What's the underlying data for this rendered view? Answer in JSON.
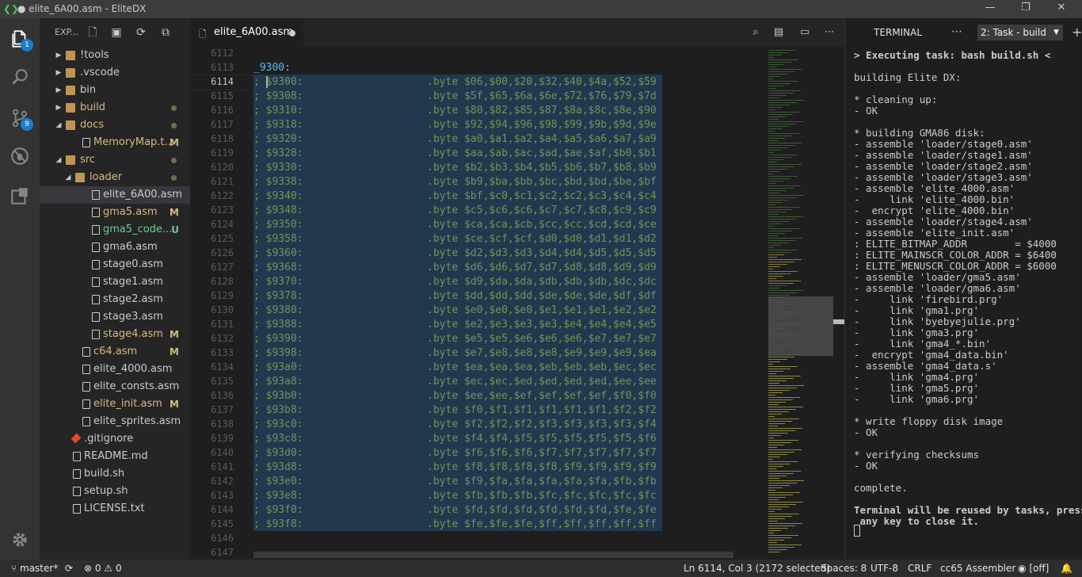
{
  "window": {
    "title": "● elite_6A00.asm - EliteDX",
    "minimize": "—",
    "maximize": "❐",
    "close": "✕"
  },
  "activity": {
    "explorer_badge": "1",
    "scm_badge": "9"
  },
  "explorer": {
    "header": "EXP...",
    "rows": [
      {
        "name": "!tools",
        "type": "folder",
        "open": false,
        "depth": 0,
        "color": "#cccccc",
        "status": ""
      },
      {
        "name": ".vscode",
        "type": "folder",
        "open": false,
        "depth": 0,
        "color": "#cccccc",
        "status": ""
      },
      {
        "name": "bin",
        "type": "folder",
        "open": false,
        "depth": 0,
        "color": "#cccccc",
        "status": ""
      },
      {
        "name": "build",
        "type": "folder",
        "open": false,
        "depth": 0,
        "color": "#d7ba7d",
        "status": "dot"
      },
      {
        "name": "docs",
        "type": "folder",
        "open": true,
        "depth": 0,
        "color": "#d7ba7d",
        "status": "dot"
      },
      {
        "name": "MemoryMap.t...",
        "type": "file",
        "depth": 1,
        "color": "#d7ba7d",
        "status": "M"
      },
      {
        "name": "src",
        "type": "folder",
        "open": true,
        "depth": 0,
        "color": "#d7ba7d",
        "status": "dot"
      },
      {
        "name": "loader",
        "type": "folder",
        "open": true,
        "depth": 1,
        "color": "#d7ba7d",
        "status": "dot"
      },
      {
        "name": "elite_6A00.asm",
        "type": "file",
        "depth": 2,
        "color": "#cccccc",
        "status": "",
        "selected": true
      },
      {
        "name": "gma5.asm",
        "type": "file",
        "depth": 2,
        "color": "#d7ba7d",
        "status": "M"
      },
      {
        "name": "gma5_code....",
        "type": "file",
        "depth": 2,
        "color": "#73c991",
        "status": "U"
      },
      {
        "name": "gma6.asm",
        "type": "file",
        "depth": 2,
        "color": "#cccccc",
        "status": ""
      },
      {
        "name": "stage0.asm",
        "type": "file",
        "depth": 2,
        "color": "#cccccc",
        "status": ""
      },
      {
        "name": "stage1.asm",
        "type": "file",
        "depth": 2,
        "color": "#cccccc",
        "status": ""
      },
      {
        "name": "stage2.asm",
        "type": "file",
        "depth": 2,
        "color": "#cccccc",
        "status": ""
      },
      {
        "name": "stage3.asm",
        "type": "file",
        "depth": 2,
        "color": "#cccccc",
        "status": ""
      },
      {
        "name": "stage4.asm",
        "type": "file",
        "depth": 2,
        "color": "#d7ba7d",
        "status": "M"
      },
      {
        "name": "c64.asm",
        "type": "file",
        "depth": 1,
        "color": "#d7ba7d",
        "status": "M"
      },
      {
        "name": "elite_4000.asm",
        "type": "file",
        "depth": 1,
        "color": "#cccccc",
        "status": ""
      },
      {
        "name": "elite_consts.asm",
        "type": "file",
        "depth": 1,
        "color": "#cccccc",
        "status": ""
      },
      {
        "name": "elite_init.asm",
        "type": "file",
        "depth": 1,
        "color": "#d7ba7d",
        "status": "M"
      },
      {
        "name": "elite_sprites.asm",
        "type": "file",
        "depth": 1,
        "color": "#cccccc",
        "status": ""
      },
      {
        "name": ".gitignore",
        "type": "file",
        "depth": 0,
        "color": "#cccccc",
        "status": ""
      },
      {
        "name": "README.md",
        "type": "file",
        "depth": 0,
        "color": "#cccccc",
        "status": ""
      },
      {
        "name": "build.sh",
        "type": "file",
        "depth": 0,
        "color": "#cccccc",
        "status": ""
      },
      {
        "name": "setup.sh",
        "type": "file",
        "depth": 0,
        "color": "#cccccc",
        "status": ""
      },
      {
        "name": "LICENSE.txt",
        "type": "file",
        "depth": 0,
        "color": "#cccccc",
        "status": ""
      }
    ]
  },
  "editor": {
    "tab": {
      "name": "elite_6A00.asm"
    },
    "lines": [
      {
        "n": "6112",
        "text": "",
        "kind": "plain"
      },
      {
        "n": "6113",
        "text": "_9300:",
        "kind": "label"
      },
      {
        "n": "6114",
        "text": "; $9300:                    .byte $06,$00,$20,$32,$40,$4a,$52,$59",
        "kind": "comment",
        "current": true
      },
      {
        "n": "6115",
        "text": "; $9308:                    .byte $5f,$65,$6a,$6e,$72,$76,$79,$7d",
        "kind": "comment"
      },
      {
        "n": "6116",
        "text": "; $9310:                    .byte $80,$82,$85,$87,$8a,$8c,$8e,$90",
        "kind": "comment"
      },
      {
        "n": "6117",
        "text": "; $9318:                    .byte $92,$94,$96,$98,$99,$9b,$9d,$9e",
        "kind": "comment"
      },
      {
        "n": "6118",
        "text": "; $9320:                    .byte $a0,$a1,$a2,$a4,$a5,$a6,$a7,$a9",
        "kind": "comment"
      },
      {
        "n": "6119",
        "text": "; $9328:                    .byte $aa,$ab,$ac,$ad,$ae,$af,$b0,$b1",
        "kind": "comment"
      },
      {
        "n": "6120",
        "text": "; $9330:                    .byte $b2,$b3,$b4,$b5,$b6,$b7,$b8,$b9",
        "kind": "comment"
      },
      {
        "n": "6121",
        "text": "; $9338:                    .byte $b9,$ba,$bb,$bc,$bd,$bd,$be,$bf",
        "kind": "comment"
      },
      {
        "n": "6122",
        "text": "; $9340:                    .byte $bf,$c0,$c1,$c2,$c2,$c3,$c4,$c4",
        "kind": "comment"
      },
      {
        "n": "6123",
        "text": "; $9348:                    .byte $c5,$c6,$c6,$c7,$c7,$c8,$c9,$c9",
        "kind": "comment"
      },
      {
        "n": "6124",
        "text": "; $9350:                    .byte $ca,$ca,$cb,$cc,$cc,$cd,$cd,$ce",
        "kind": "comment"
      },
      {
        "n": "6125",
        "text": "; $9358:                    .byte $ce,$cf,$cf,$d0,$d0,$d1,$d1,$d2",
        "kind": "comment"
      },
      {
        "n": "6126",
        "text": "; $9360:                    .byte $d2,$d3,$d3,$d4,$d4,$d5,$d5,$d5",
        "kind": "comment"
      },
      {
        "n": "6127",
        "text": "; $9368:                    .byte $d6,$d6,$d7,$d7,$d8,$d8,$d9,$d9",
        "kind": "comment"
      },
      {
        "n": "6128",
        "text": "; $9370:                    .byte $d9,$da,$da,$db,$db,$db,$dc,$dc",
        "kind": "comment"
      },
      {
        "n": "6129",
        "text": "; $9378:                    .byte $dd,$dd,$dd,$de,$de,$de,$df,$df",
        "kind": "comment"
      },
      {
        "n": "6130",
        "text": "; $9380:                    .byte $e0,$e0,$e0,$e1,$e1,$e1,$e2,$e2",
        "kind": "comment"
      },
      {
        "n": "6131",
        "text": "; $9388:                    .byte $e2,$e3,$e3,$e3,$e4,$e4,$e4,$e5",
        "kind": "comment"
      },
      {
        "n": "6132",
        "text": "; $9390:                    .byte $e5,$e5,$e6,$e6,$e6,$e7,$e7,$e7",
        "kind": "comment"
      },
      {
        "n": "6133",
        "text": "; $9398:                    .byte $e7,$e8,$e8,$e8,$e9,$e9,$e9,$ea",
        "kind": "comment"
      },
      {
        "n": "6134",
        "text": "; $93a0:                    .byte $ea,$ea,$ea,$eb,$eb,$eb,$ec,$ec",
        "kind": "comment"
      },
      {
        "n": "6135",
        "text": "; $93a8:                    .byte $ec,$ec,$ed,$ed,$ed,$ed,$ee,$ee",
        "kind": "comment"
      },
      {
        "n": "6136",
        "text": "; $93b0:                    .byte $ee,$ee,$ef,$ef,$ef,$ef,$f0,$f0",
        "kind": "comment"
      },
      {
        "n": "6137",
        "text": "; $93b8:                    .byte $f0,$f1,$f1,$f1,$f1,$f1,$f2,$f2",
        "kind": "comment"
      },
      {
        "n": "6138",
        "text": "; $93c0:                    .byte $f2,$f2,$f2,$f3,$f3,$f3,$f3,$f4",
        "kind": "comment"
      },
      {
        "n": "6139",
        "text": "; $93c8:                    .byte $f4,$f4,$f5,$f5,$f5,$f5,$f5,$f6",
        "kind": "comment"
      },
      {
        "n": "6140",
        "text": "; $93d0:                    .byte $f6,$f6,$f6,$f7,$f7,$f7,$f7,$f7",
        "kind": "comment"
      },
      {
        "n": "6141",
        "text": "; $93d8:                    .byte $f8,$f8,$f8,$f8,$f9,$f9,$f9,$f9",
        "kind": "comment"
      },
      {
        "n": "6142",
        "text": "; $93e0:                    .byte $f9,$fa,$fa,$fa,$fa,$fa,$fb,$fb",
        "kind": "comment"
      },
      {
        "n": "6143",
        "text": "; $93e8:                    .byte $fb,$fb,$fb,$fc,$fc,$fc,$fc,$fc",
        "kind": "comment"
      },
      {
        "n": "6144",
        "text": "; $93f0:                    .byte $fd,$fd,$fd,$fd,$fd,$fd,$fe,$fe",
        "kind": "comment"
      },
      {
        "n": "6145",
        "text": "; $93f8:                    .byte $fe,$fe,$fe,$ff,$ff,$ff,$ff,$ff",
        "kind": "comment"
      },
      {
        "n": "6146",
        "text": "",
        "kind": "plain"
      },
      {
        "n": "6147",
        "text": "",
        "kind": "plain"
      }
    ]
  },
  "terminal": {
    "title": "TERMINAL",
    "task_select": "2: Task - build",
    "lines": [
      {
        "t": "> Executing task: bash build.sh <",
        "bold": true
      },
      {
        "t": "",
        "bold": false
      },
      {
        "t": "building Elite DX:",
        "bold": false
      },
      {
        "t": "",
        "bold": false
      },
      {
        "t": "* cleaning up:",
        "bold": false
      },
      {
        "t": "- OK",
        "bold": false
      },
      {
        "t": "",
        "bold": false
      },
      {
        "t": "* building GMA86 disk:",
        "bold": false
      },
      {
        "t": "- assemble 'loader/stage0.asm'",
        "bold": false
      },
      {
        "t": "- assemble 'loader/stage1.asm'",
        "bold": false
      },
      {
        "t": "- assemble 'loader/stage2.asm'",
        "bold": false
      },
      {
        "t": "- assemble 'loader/stage3.asm'",
        "bold": false
      },
      {
        "t": "- assemble 'elite_4000.asm'",
        "bold": false
      },
      {
        "t": "-     link 'elite_4000.bin'",
        "bold": false
      },
      {
        "t": "-  encrypt 'elite_4000.bin'",
        "bold": false
      },
      {
        "t": "- assemble 'loader/stage4.asm'",
        "bold": false
      },
      {
        "t": "- assemble 'elite_init.asm'",
        "bold": false
      },
      {
        "t": ": ELITE_BITMAP_ADDR        = $4000",
        "bold": false
      },
      {
        "t": ": ELITE_MAINSCR_COLOR_ADDR = $6400",
        "bold": false
      },
      {
        "t": ": ELITE_MENUSCR_COLOR_ADDR = $6000",
        "bold": false
      },
      {
        "t": "- assemble 'loader/gma5.asm'",
        "bold": false
      },
      {
        "t": "- assemble 'loader/gma6.asm'",
        "bold": false
      },
      {
        "t": "-     link 'firebird.prg'",
        "bold": false
      },
      {
        "t": "-     link 'gma1.prg'",
        "bold": false
      },
      {
        "t": "-     link 'byebyejulie.prg'",
        "bold": false
      },
      {
        "t": "-     link 'gma3.prg'",
        "bold": false
      },
      {
        "t": "-     link 'gma4_*.bin'",
        "bold": false
      },
      {
        "t": "-  encrypt 'gma4_data.bin'",
        "bold": false
      },
      {
        "t": "- assemble 'gma4_data.s'",
        "bold": false
      },
      {
        "t": "-     link 'gma4.prg'",
        "bold": false
      },
      {
        "t": "-     link 'gma5.prg'",
        "bold": false
      },
      {
        "t": "-     link 'gma6.prg'",
        "bold": false
      },
      {
        "t": "",
        "bold": false
      },
      {
        "t": "* write floppy disk image",
        "bold": false
      },
      {
        "t": "- OK",
        "bold": false
      },
      {
        "t": "",
        "bold": false
      },
      {
        "t": "* verifying checksums",
        "bold": false
      },
      {
        "t": "- OK",
        "bold": false
      },
      {
        "t": "",
        "bold": false
      },
      {
        "t": "complete.",
        "bold": false
      },
      {
        "t": "",
        "bold": false
      },
      {
        "t": "Terminal will be reused by tasks, press",
        "bold": true
      },
      {
        "t": " any key to close it.",
        "bold": true
      }
    ]
  },
  "status": {
    "branch": "master*",
    "errors": "0",
    "warnings": "0",
    "position": "Ln 6114, Col 3 (2172 selected)",
    "spaces": "Spaces: 8",
    "encoding": "UTF-8",
    "eol": "CRLF",
    "language": "cc65 Assembler",
    "live": "[off]"
  }
}
